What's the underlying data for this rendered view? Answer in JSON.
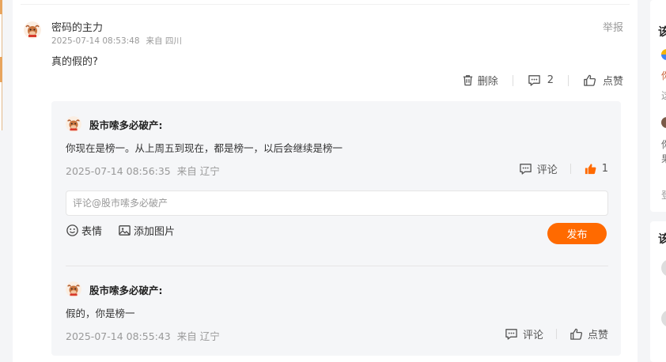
{
  "comment": {
    "username": "密码的主力",
    "time": "2025-07-14 08:53:48",
    "location": "来自 四川",
    "report_label": "举报",
    "text": "真的假的?",
    "actions": {
      "delete_label": "删除",
      "comment_count": "2",
      "like_label": "点赞"
    }
  },
  "replies": [
    {
      "username": "股市嗦多必破产:",
      "text": "你现在是榜一。从上周五到现在，都是榜一，以后会继续是榜一",
      "time": "2025-07-14 08:56:35",
      "location": "来自 辽宁",
      "comment_label": "评论",
      "like_value": "1"
    },
    {
      "username": "股市嗦多必破产:",
      "text": "假的，你是榜一",
      "time": "2025-07-14 08:55:43",
      "location": "来自 辽宁",
      "comment_label": "评论",
      "like_value": "点赞"
    }
  ],
  "reply_input": {
    "placeholder": "评论@股市嗦多必破产",
    "emoji_label": "表情",
    "image_label": "添加图片",
    "publish_label": "发布"
  },
  "right_sidebar": {
    "card1_title": "该",
    "card1_fragments": [
      "你",
      "这",
      "你",
      "果",
      "登"
    ],
    "card2_title": "该"
  },
  "colors": {
    "accent": "#ff6a00",
    "liked": "#ff6a00",
    "muted": "#999999"
  },
  "icons": {
    "delete": "trash-icon",
    "comment": "comment-bubble-icon",
    "like": "thumb-up-icon",
    "emoji": "smile-icon",
    "image": "image-icon"
  }
}
